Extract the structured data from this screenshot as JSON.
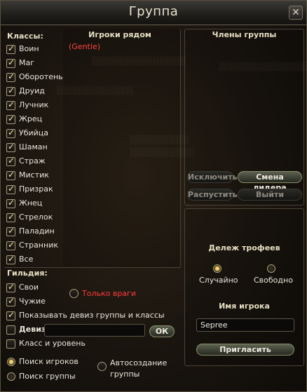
{
  "window": {
    "title": "Группа",
    "close": "✕"
  },
  "classes": {
    "header": "Классы:",
    "items": [
      {
        "label": "Воин",
        "checked": true
      },
      {
        "label": "Маг",
        "checked": true
      },
      {
        "label": "Оборотень",
        "checked": true
      },
      {
        "label": "Друид",
        "checked": true
      },
      {
        "label": "Лучник",
        "checked": true
      },
      {
        "label": "Жрец",
        "checked": true
      },
      {
        "label": "Убийца",
        "checked": true
      },
      {
        "label": "Шаман",
        "checked": true
      },
      {
        "label": "Страж",
        "checked": true
      },
      {
        "label": "Мистик",
        "checked": true
      },
      {
        "label": "Призрак",
        "checked": true
      },
      {
        "label": "Жнец",
        "checked": true
      },
      {
        "label": "Стрелок",
        "checked": true
      },
      {
        "label": "Паладин",
        "checked": true
      },
      {
        "label": "Странник",
        "checked": true
      },
      {
        "label": "Все",
        "checked": true
      }
    ]
  },
  "guild": {
    "header": "Гильдия:",
    "own": "Свои",
    "foreign": "Чужие",
    "enemies_only": "Только враги",
    "show_motto": "Показывать девиз группы и классы",
    "motto": "Девиз",
    "motto_value": "",
    "ok": "ОК",
    "class_level": "Класс и уровень",
    "search_players": "Поиск игроков",
    "search_group": "Поиск группы",
    "auto_create": "Автосоздание группы"
  },
  "nearby": {
    "header": "Игроки рядом",
    "player_tag": "(Gentle)"
  },
  "members": {
    "header": "Члены группы",
    "kick": "Исключить",
    "leader": "Смена лидера",
    "disband": "Распустить",
    "leave": "Выйти"
  },
  "loot": {
    "header": "Дележ трофеев",
    "random": "Случайно",
    "free": "Свободно"
  },
  "invite": {
    "header": "Имя игрока",
    "name_value": "Sepree",
    "button": "Пригласить"
  },
  "colors": {
    "enemy_text": "#ff3b3b",
    "nearby_tag": "#ff4444",
    "accent": "#e6dfc4"
  }
}
